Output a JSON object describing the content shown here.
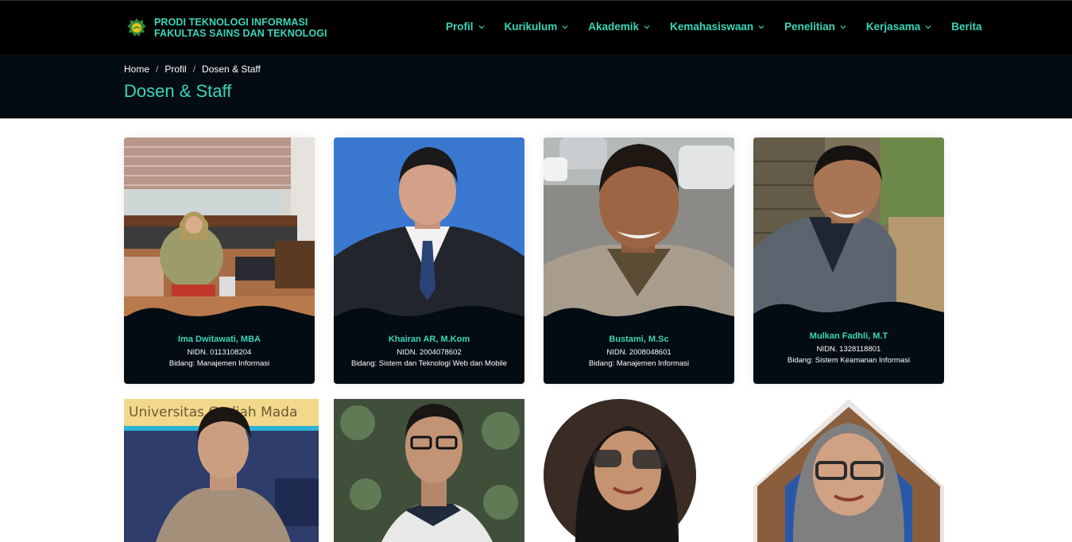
{
  "header": {
    "brand_line1": "PRODI TEKNOLOGI INFORMASI",
    "brand_line2": "FAKULTAS SAINS DAN TEKNOLOGI",
    "nav": [
      {
        "label": "Profil",
        "dropdown": true
      },
      {
        "label": "Kurikulum",
        "dropdown": true
      },
      {
        "label": "Akademik",
        "dropdown": true
      },
      {
        "label": "Kemahasiswaan",
        "dropdown": true
      },
      {
        "label": "Penelitian",
        "dropdown": true
      },
      {
        "label": "Kerjasama",
        "dropdown": true
      },
      {
        "label": "Berita",
        "dropdown": false
      }
    ]
  },
  "breadcrumb": [
    "Home",
    "Profil",
    "Dosen & Staff"
  ],
  "page_title": "Dosen & Staff",
  "cards": [
    {
      "name": "Ima Dwitawati, MBA",
      "nidn": "NIDN. 0113108204",
      "bidang": "Bidang: Manajemen Informasi"
    },
    {
      "name": "Khairan AR, M.Kom",
      "nidn": "NIDN. 2004078602",
      "bidang": "Bidang: Sistem dan Teknologi Web dan Mobile"
    },
    {
      "name": "Bustami, M.Sc",
      "nidn": "NIDN. 2008048601",
      "bidang": "Bidang: Manajemen Informasi"
    },
    {
      "name": "Mulkan Fadhli, M.T",
      "nidn": "NIDN. 1328118801",
      "bidang": "Bidang: Sistem Keamanan Informasi"
    }
  ],
  "row2_banner_text": "Universitas Gadjah Mada",
  "colors": {
    "accent": "#3ad6b9",
    "dark": "#030c12",
    "topbar": "#000000"
  }
}
